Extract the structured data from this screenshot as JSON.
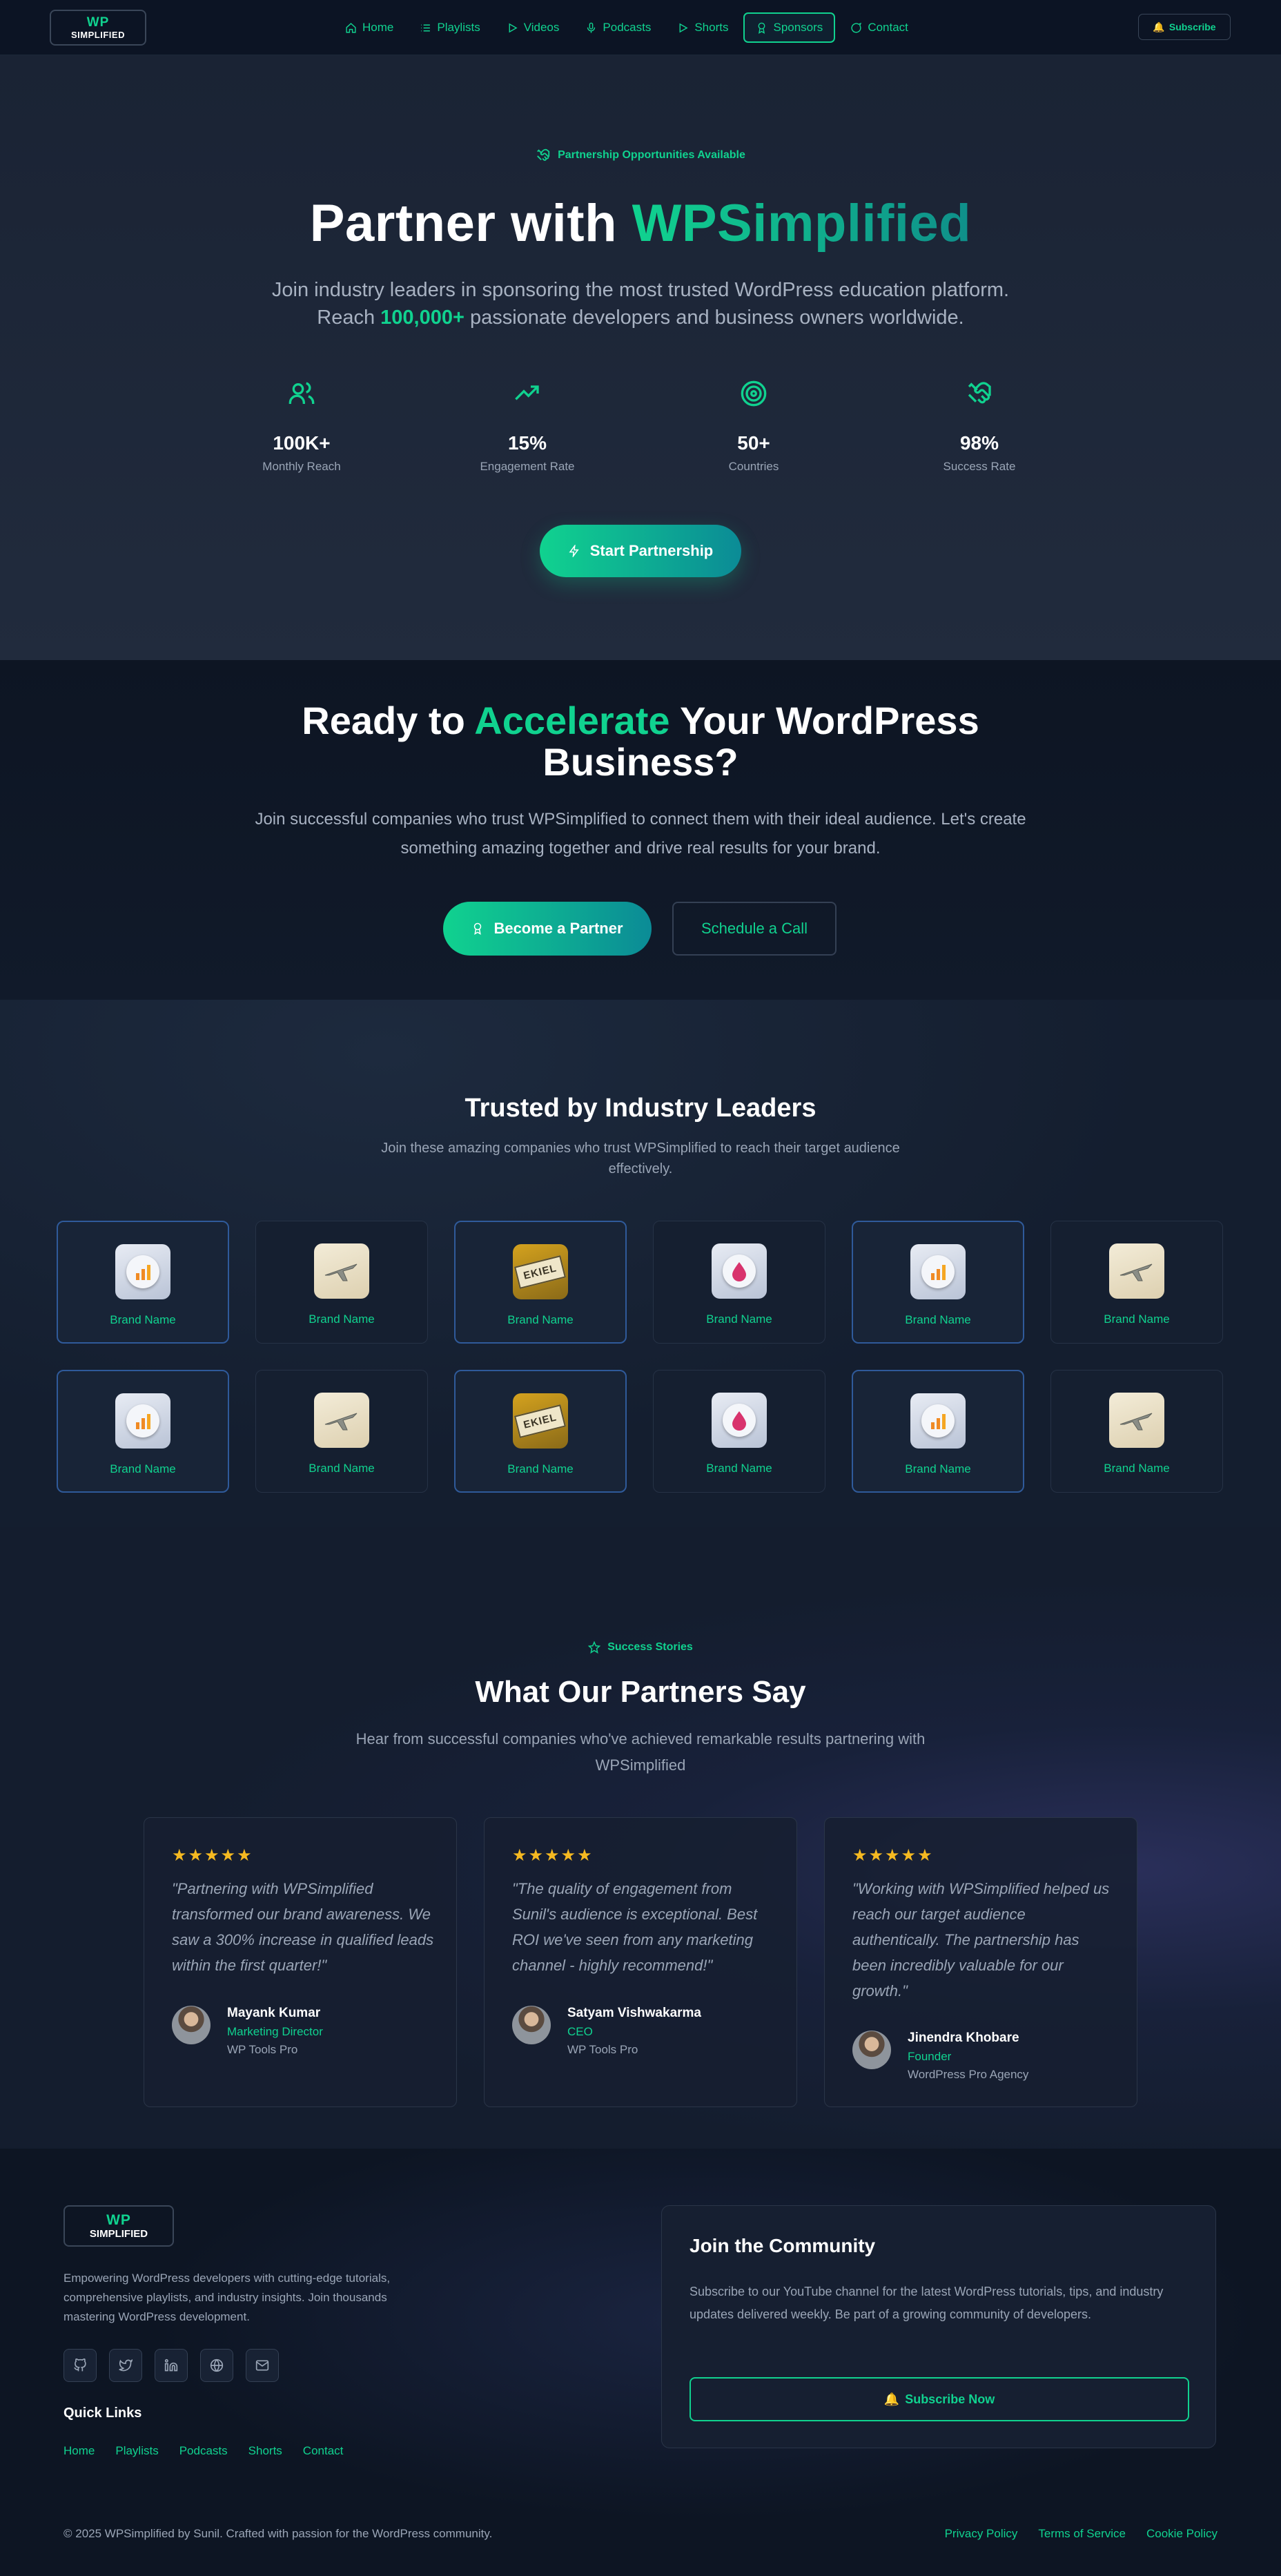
{
  "header": {
    "logo": {
      "line1": "WP",
      "line2": "SIMPLIFIED"
    },
    "nav": [
      {
        "label": "Home",
        "icon": "home-icon"
      },
      {
        "label": "Playlists",
        "icon": "list-icon"
      },
      {
        "label": "Videos",
        "icon": "play-icon"
      },
      {
        "label": "Podcasts",
        "icon": "mic-icon"
      },
      {
        "label": "Shorts",
        "icon": "play-icon"
      },
      {
        "label": "Sponsors",
        "icon": "award-icon",
        "active": true
      },
      {
        "label": "Contact",
        "icon": "message-icon"
      }
    ],
    "subscribe_label": "Subscribe",
    "subscribe_emoji": "🔔"
  },
  "hero": {
    "pill": "Partnership Opportunities Available",
    "title_prefix": "Partner with ",
    "title_highlight": "WPSimplified",
    "subtitle_line1": "Join industry leaders in sponsoring the most trusted WordPress education platform.",
    "subtitle_line2_prefix": "Reach ",
    "subtitle_line2_highlight": "100,000+",
    "subtitle_line2_suffix": " passionate developers and business owners worldwide.",
    "stats": [
      {
        "value": "100K+",
        "label": "Monthly Reach",
        "icon": "users-icon"
      },
      {
        "value": "15%",
        "label": "Engagement Rate",
        "icon": "trending-up-icon"
      },
      {
        "value": "50+",
        "label": "Countries",
        "icon": "target-icon"
      },
      {
        "value": "98%",
        "label": "Success Rate",
        "icon": "handshake-icon"
      }
    ],
    "cta_label": "Start Partnership"
  },
  "ready": {
    "title_prefix": "Ready to ",
    "title_highlight": "Accelerate",
    "title_suffix": " Your WordPress",
    "title_line2": "Business?",
    "subtitle": "Join successful companies who trust WPSimplified to connect them with their ideal audience. Let's create something amazing together and drive real results for your brand.",
    "primary_label": "Become a Partner",
    "secondary_label": "Schedule a Call"
  },
  "trusted": {
    "title": "Trusted by Industry Leaders",
    "subtitle": "Join these amazing companies who trust WPSimplified to reach their target audience effectively.",
    "brands": [
      {
        "name": "Brand Name",
        "art": "chart"
      },
      {
        "name": "Brand Name",
        "art": "plane"
      },
      {
        "name": "Brand Name",
        "art": "tag",
        "tag_text": "EKIEL"
      },
      {
        "name": "Brand Name",
        "art": "drop"
      },
      {
        "name": "Brand Name",
        "art": "chart"
      },
      {
        "name": "Brand Name",
        "art": "plane"
      },
      {
        "name": "Brand Name",
        "art": "chart"
      },
      {
        "name": "Brand Name",
        "art": "plane"
      },
      {
        "name": "Brand Name",
        "art": "tag",
        "tag_text": "EKIEL"
      },
      {
        "name": "Brand Name",
        "art": "drop"
      },
      {
        "name": "Brand Name",
        "art": "chart"
      },
      {
        "name": "Brand Name",
        "art": "plane"
      }
    ]
  },
  "testimonials": {
    "pill": "Success Stories",
    "title": "What Our Partners Say",
    "subtitle": "Hear from successful companies who've achieved remarkable results partnering with WPSimplified",
    "stars": "★★★★★",
    "items": [
      {
        "quote": "\"Partnering with WPSimplified transformed our brand awareness. We saw a 300% increase in qualified leads within the first quarter!\"",
        "name": "Mayank Kumar",
        "role": "Marketing Director",
        "company": "WP Tools Pro"
      },
      {
        "quote": "\"The quality of engagement from Sunil's audience is exceptional. Best ROI we've seen from any marketing channel - highly recommend!\"",
        "name": "Satyam Vishwakarma",
        "role": "CEO",
        "company": "WP Tools Pro"
      },
      {
        "quote": "\"Working with WPSimplified helped us reach our target audience authentically. The partnership has been incredibly valuable for our growth.\"",
        "name": "Jinendra Khobare",
        "role": "Founder",
        "company": "WordPress Pro Agency"
      }
    ]
  },
  "footer": {
    "logo": {
      "line1": "WP",
      "line2": "SIMPLIFIED"
    },
    "description": "Empowering WordPress developers with cutting-edge tutorials, comprehensive playlists, and industry insights. Join thousands mastering WordPress development.",
    "socials": [
      "github-icon",
      "twitter-icon",
      "linkedin-icon",
      "globe-icon",
      "mail-icon"
    ],
    "quick_links_title": "Quick Links",
    "quick_links": [
      "Home",
      "Playlists",
      "Podcasts",
      "Shorts",
      "Contact"
    ],
    "community": {
      "title": "Join the Community",
      "description": "Subscribe to our YouTube channel for the latest WordPress tutorials, tips, and industry updates delivered weekly. Be part of a growing community of developers.",
      "button_label": "Subscribe Now",
      "button_emoji": "🔔"
    },
    "copyright": "© 2025 WPSimplified by Sunil. Crafted with passion for the WordPress community.",
    "legal": [
      "Privacy Policy",
      "Terms of Service",
      "Cookie Policy"
    ]
  },
  "colors": {
    "accent": "#10d28f",
    "teal": "#0b8b96",
    "bg": "#111a2a",
    "star": "#f5b921"
  }
}
